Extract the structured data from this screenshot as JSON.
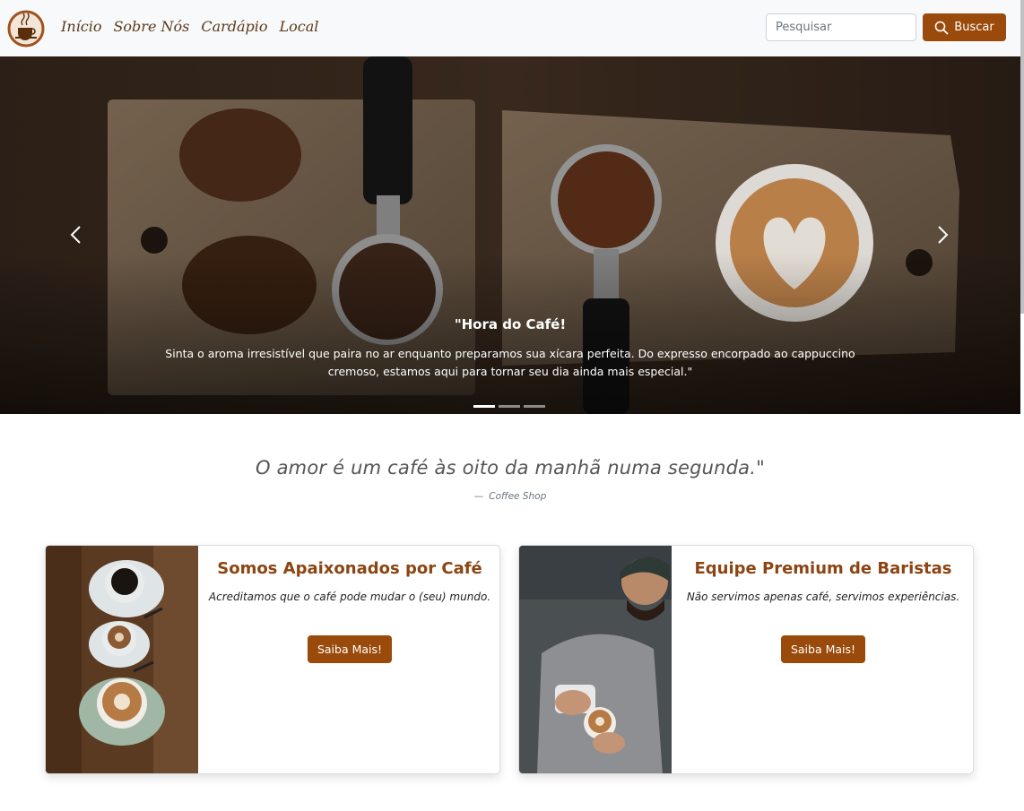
{
  "colors": {
    "accent": "#9a4a0a",
    "title_brown": "#8b4513",
    "nav_text": "#5a3a1a"
  },
  "navbar": {
    "logo_icon": "coffee-cup-logo",
    "links": [
      "Início",
      "Sobre Nós",
      "Cardápio",
      "Local"
    ],
    "search_placeholder": "Pesquisar",
    "search_button": "Buscar"
  },
  "carousel": {
    "caption_title": "\"Hora do Café!",
    "caption_text": "Sinta o aroma irresistível que paira no ar enquanto preparamos sua xícara perfeita. Do expresso encorpado ao cappuccino cremoso, estamos aqui para tornar seu dia ainda mais especial.\"",
    "slide_count": 3,
    "active_slide": 1
  },
  "quote": {
    "text": "O amor é um café às oito da manhã numa segunda.\"",
    "dash": "—",
    "source": "Coffee Shop"
  },
  "cards": [
    {
      "title": "Somos Apaixonados por Café",
      "text": "Acreditamos que o café pode mudar o (seu) mundo.",
      "button": "Saiba Mais!"
    },
    {
      "title": "Equipe Premium de Baristas",
      "text": "Não servimos apenas café, servimos experiências.",
      "button": "Saiba Mais!"
    }
  ]
}
